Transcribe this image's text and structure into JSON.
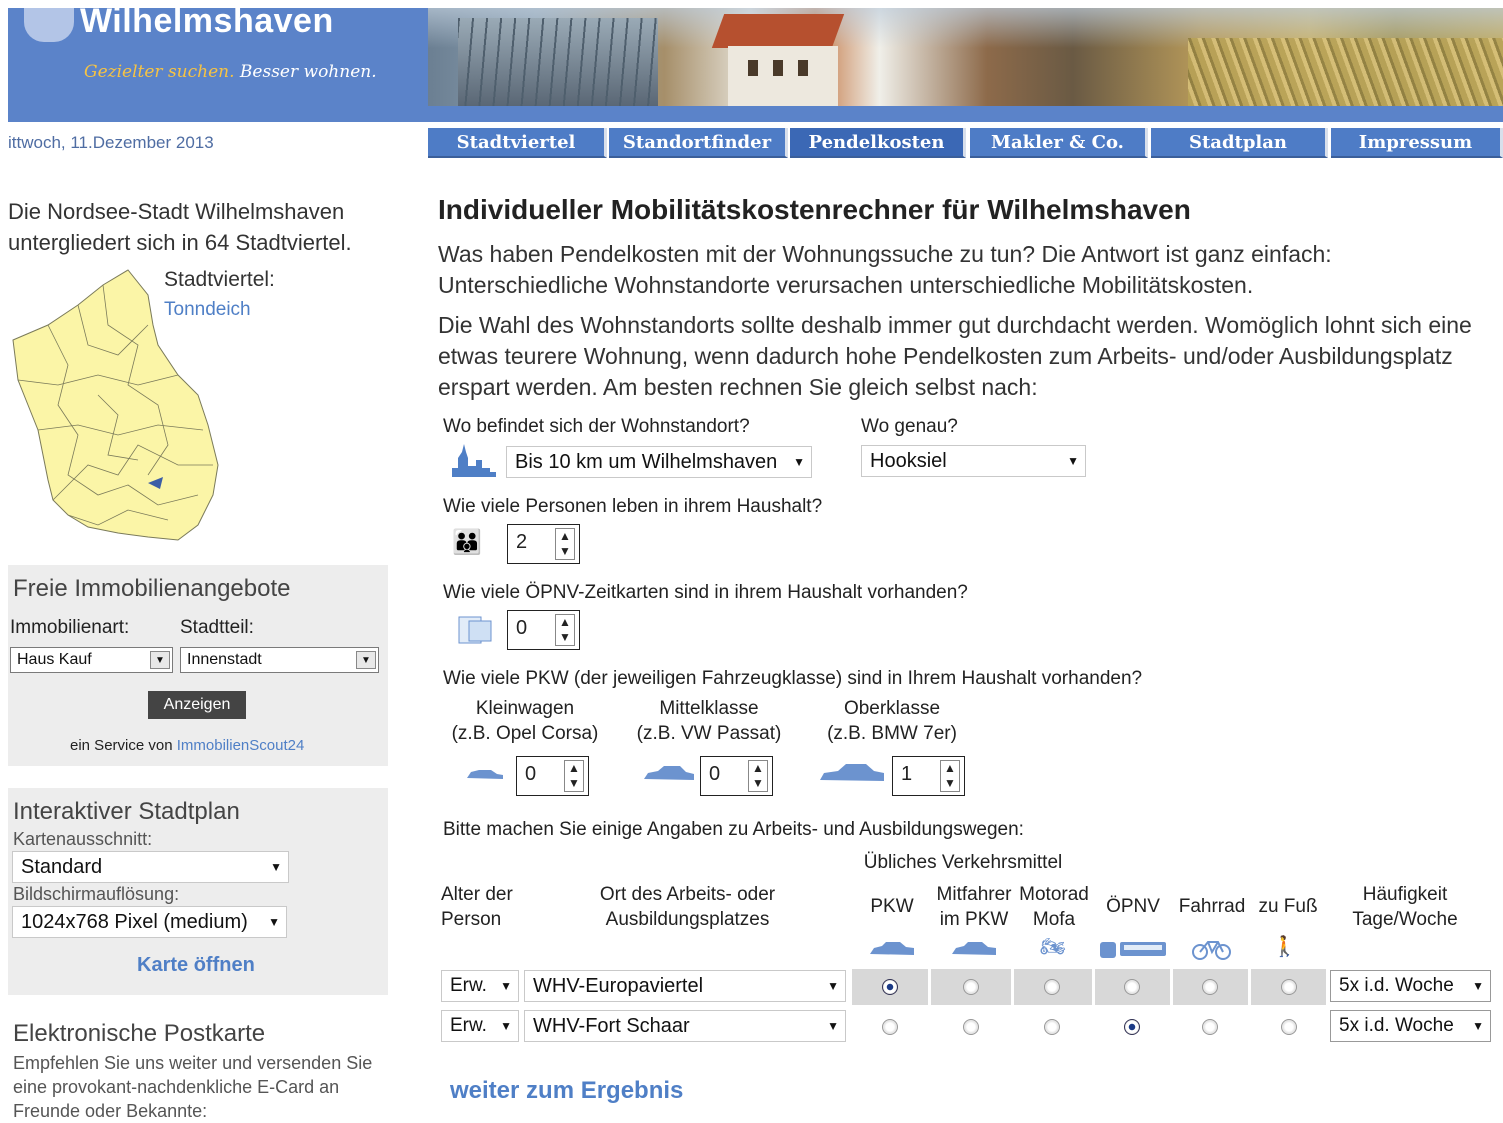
{
  "header": {
    "title": "Wilhelmshaven",
    "slogan_part1": "Gezielter suchen.",
    "slogan_part2": "Besser wohnen."
  },
  "date": "ittwoch, 11.Dezember 2013",
  "nav": [
    "Stadtviertel",
    "Standortfinder",
    "Pendelkosten",
    "Makler & Co.",
    "Stadtplan",
    "Impressum"
  ],
  "sidebar": {
    "intro": "Die Nordsee-Stadt Wilhelmshaven untergliedert sich in 64 Stadtviertel.",
    "district_label": "Stadtviertel:",
    "district_value": "Tonndeich",
    "immo": {
      "title": "Freie Immobilienangebote",
      "art_label": "Immobilienart:",
      "teil_label": "Stadtteil:",
      "art_value": "Haus Kauf",
      "teil_value": "Innenstadt",
      "button": "Anzeigen",
      "service_prefix": "ein Service von ",
      "service_link": "ImmobilienScout24"
    },
    "map": {
      "title": "Interaktiver Stadtplan",
      "k_label": "Kartenausschnitt:",
      "k_value": "Standard",
      "b_label": "Bildschirmauflösung:",
      "b_value": "1024x768 Pixel (medium)",
      "link": "Karte öffnen"
    },
    "postcard": {
      "title": "Elektronische Postkarte",
      "text": "Empfehlen Sie uns weiter und versenden Sie eine provokant-nachdenkliche E-Card an Freunde oder Bekannte:"
    }
  },
  "main": {
    "title": "Individueller Mobilitätskostenrechner für Wilhelmshaven",
    "p1": "Was haben Pendelkosten mit der Wohnungssuche zu tun? Die Antwort ist ganz einfach: Unterschiedliche Wohnstandorte verursachen unterschiedliche Mobilitätskosten.",
    "p2": "Die Wahl des Wohnstandorts sollte deshalb immer gut durchdacht werden. Womöglich lohnt sich eine etwas teurere Wohnung, wenn dadurch hohe Pendelkosten zum Arbeits- und/oder Ausbildungsplatz erspart werden. Am besten rechnen Sie gleich selbst nach:",
    "q_location": "Wo befindet sich der Wohnstandort?",
    "location_value": "Bis 10 km um Wilhelmshaven",
    "q_where": "Wo genau?",
    "where_value": "Hooksiel",
    "q_persons": "Wie viele Personen leben in ihrem Haushalt?",
    "persons_value": "2",
    "q_cards": "Wie viele ÖPNV-Zeitkarten sind in ihrem Haushalt vorhanden?",
    "cards_value": "0",
    "q_cars": "Wie viele PKW (der jeweiligen Fahrzeugklasse) sind in Ihrem Haushalt vorhanden?",
    "car_classes": [
      {
        "name": "Kleinwagen",
        "example": "(z.B. Opel Corsa)",
        "value": "0"
      },
      {
        "name": "Mittelklasse",
        "example": "(z.B. VW Passat)",
        "value": "0"
      },
      {
        "name": "Oberklasse",
        "example": "(z.B. BMW 7er)",
        "value": "1"
      }
    ],
    "q_ways": "Bitte machen Sie einige Angaben zu Arbeits- und Ausbildungswegen:",
    "modes_header": "Übliches Verkehrsmittel",
    "col_age": "Alter der Person",
    "col_place": "Ort des Arbeits- oder Ausbildungsplatzes",
    "col_freq": "Häufigkeit Tage/Woche",
    "modes": [
      "PKW",
      "Mitfahrer im PKW",
      "Motorad Mofa",
      "ÖPNV",
      "Fahrrad",
      "zu Fuß"
    ],
    "rows": [
      {
        "age": "Erw.",
        "place": "WHV-Europaviertel",
        "selected_mode": "PKW",
        "freq": "5x i.d. Woche"
      },
      {
        "age": "Erw.",
        "place": "WHV-Fort Schaar",
        "selected_mode": "ÖPNV",
        "freq": "5x i.d. Woche"
      }
    ],
    "next_link": "weiter zum Ergebnis"
  }
}
